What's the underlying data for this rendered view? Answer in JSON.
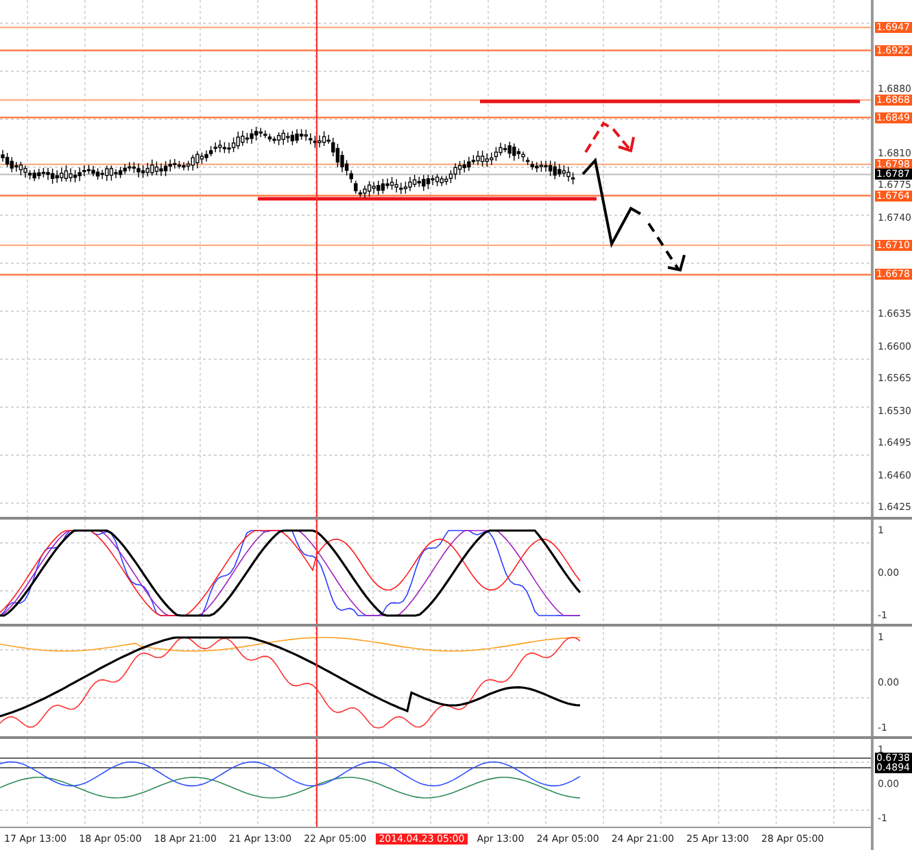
{
  "price_axis": {
    "ticks": [
      "1.6880",
      "1.6810",
      "1.6775",
      "1.6740",
      "1.6635",
      "1.6600",
      "1.6565",
      "1.6530",
      "1.6495",
      "1.6460",
      "1.6425"
    ],
    "levels": [
      {
        "price": "1.6947",
        "color": "#ffb08a"
      },
      {
        "price": "1.6922",
        "color": "#ff7a45"
      },
      {
        "price": "1.6868",
        "color": "#ffb08a"
      },
      {
        "price": "1.6849",
        "color": "#ff7a45"
      },
      {
        "price": "1.6798",
        "color": "#ffb08a"
      },
      {
        "price": "1.6764",
        "color": "#ff7a45"
      },
      {
        "price": "1.6710",
        "color": "#ffb08a"
      },
      {
        "price": "1.6678",
        "color": "#ff7a45"
      }
    ],
    "current_price": "1.6787"
  },
  "indicators": [
    {
      "labels": [
        "1",
        "0.00",
        "-1"
      ]
    },
    {
      "labels": [
        "1",
        "0.00",
        "-1"
      ]
    },
    {
      "labels": [
        "1",
        "0.00",
        "-1"
      ],
      "readings": [
        "0.6738",
        "0.4894"
      ]
    }
  ],
  "time_axis": [
    {
      "label": "17 Apr 13:00",
      "selected": false
    },
    {
      "label": "18 Apr 05:00",
      "selected": false
    },
    {
      "label": "18 Apr 21:00",
      "selected": false
    },
    {
      "label": "21 Apr 13:00",
      "selected": false
    },
    {
      "label": "22 Apr 05:00",
      "selected": false
    },
    {
      "label": "2014.04.23 05:00",
      "selected": true
    },
    {
      "label": "Apr 13:00",
      "selected": false
    },
    {
      "label": "24 Apr 05:00",
      "selected": false
    },
    {
      "label": "24 Apr 21:00",
      "selected": false
    },
    {
      "label": "25 Apr 13:00",
      "selected": false
    },
    {
      "label": "28 Apr 05:00",
      "selected": false
    }
  ]
}
